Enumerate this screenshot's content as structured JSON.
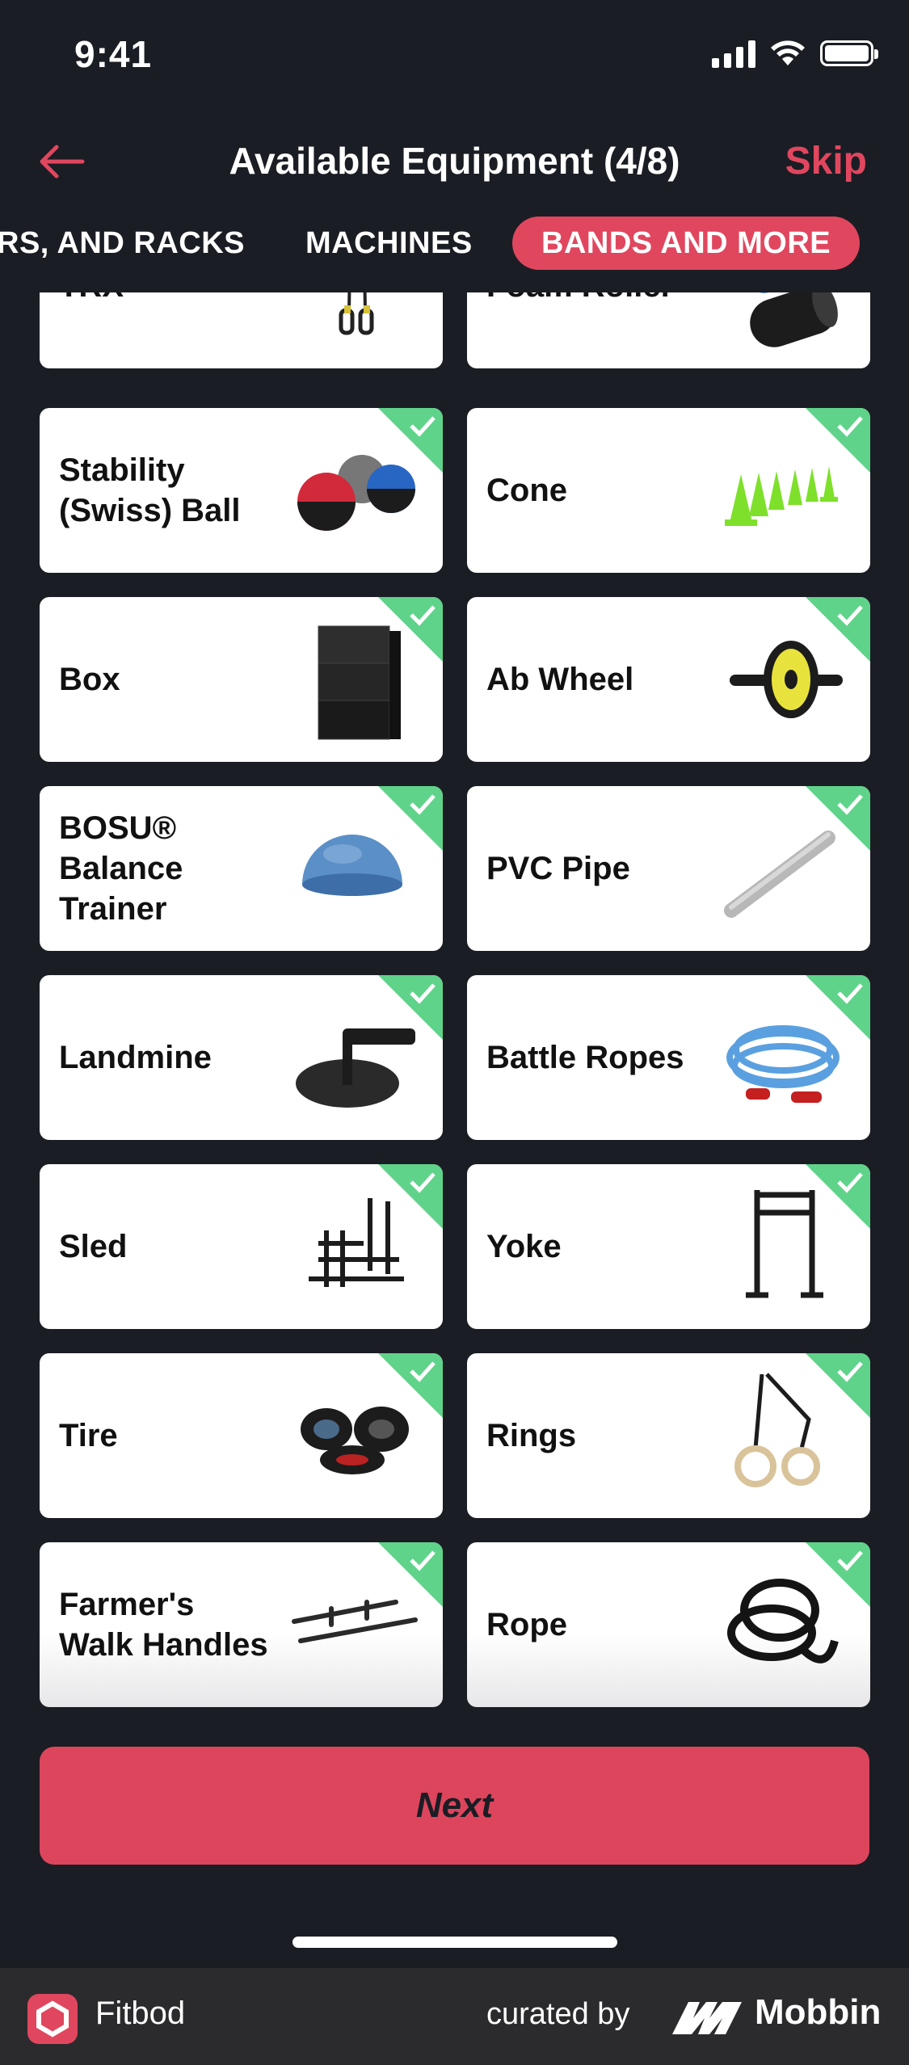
{
  "status_bar": {
    "time": "9:41"
  },
  "header": {
    "title": "Available Equipment (4/8)",
    "skip_label": "Skip"
  },
  "tabs": [
    {
      "label": "RS, AND RACKS",
      "active": false
    },
    {
      "label": "MACHINES",
      "active": false
    },
    {
      "label": "BANDS AND MORE",
      "active": true
    }
  ],
  "equipment": [
    {
      "label": "TRX",
      "checked": false
    },
    {
      "label": "Foam Roller",
      "checked": false
    },
    {
      "label": "Stability (Swiss) Ball",
      "checked": true
    },
    {
      "label": "Cone",
      "checked": true
    },
    {
      "label": "Box",
      "checked": true
    },
    {
      "label": "Ab Wheel",
      "checked": true
    },
    {
      "label": "BOSU® Balance Trainer",
      "checked": true
    },
    {
      "label": "PVC Pipe",
      "checked": true
    },
    {
      "label": "Landmine",
      "checked": true
    },
    {
      "label": "Battle Ropes",
      "checked": true
    },
    {
      "label": "Sled",
      "checked": true
    },
    {
      "label": "Yoke",
      "checked": true
    },
    {
      "label": "Tire",
      "checked": true
    },
    {
      "label": "Rings",
      "checked": true
    },
    {
      "label": "Farmer's Walk Handles",
      "checked": true
    },
    {
      "label": "Rope",
      "checked": true
    }
  ],
  "next_label": "Next",
  "footer": {
    "app_name": "Fitbod",
    "curated_by": "curated by",
    "brand": "Mobbin"
  },
  "colors": {
    "accent": "#e0475f",
    "check": "#5fd38a",
    "background": "#1b1d24"
  }
}
